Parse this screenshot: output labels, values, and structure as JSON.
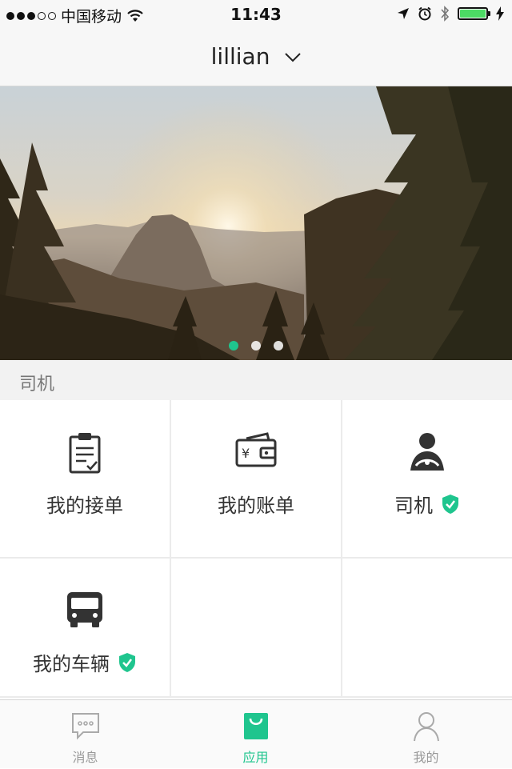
{
  "status_bar": {
    "carrier": "中国移动",
    "time": "11:43",
    "signal_dots_filled": 3,
    "signal_dots_total": 5,
    "battery_level": 1.0
  },
  "navbar": {
    "title": "lillian",
    "dropdown_icon": "chevron-down-icon"
  },
  "banner": {
    "page_count": 3,
    "active_page": 1
  },
  "section": {
    "title": "司机"
  },
  "grid": {
    "items": [
      {
        "label": "我的接单",
        "icon": "clipboard-check-icon",
        "verified": false
      },
      {
        "label": "我的账单",
        "icon": "wallet-yen-icon",
        "verified": false
      },
      {
        "label": "司机",
        "icon": "driver-icon",
        "verified": true
      },
      {
        "label": "我的车辆",
        "icon": "bus-icon",
        "verified": true
      }
    ]
  },
  "tabbar": {
    "tabs": [
      {
        "label": "消息",
        "icon": "chat-bubble-icon",
        "active": false
      },
      {
        "label": "应用",
        "icon": "shopping-bag-icon",
        "active": true
      },
      {
        "label": "我的",
        "icon": "user-icon",
        "active": false
      }
    ]
  },
  "colors": {
    "accent": "#1fc58e",
    "icon_dark": "#333333",
    "inactive": "#999999"
  }
}
